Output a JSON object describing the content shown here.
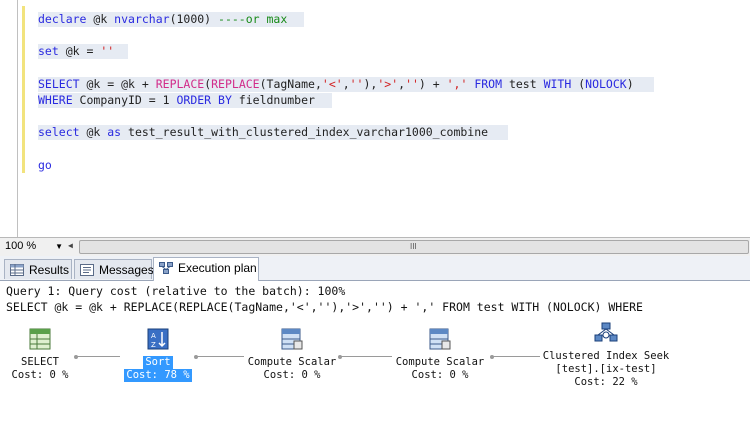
{
  "editor": {
    "lines": [
      {
        "parts": [
          {
            "t": "declare",
            "c": "kw"
          },
          {
            "t": " @k ",
            "c": "plain"
          },
          {
            "t": "nvarchar",
            "c": "kw"
          },
          {
            "t": "(1000) ",
            "c": "plain"
          },
          {
            "t": "----or max",
            "c": "cmt"
          }
        ]
      },
      {
        "parts": [
          {
            "t": "set",
            "c": "kw"
          },
          {
            "t": " @k = ",
            "c": "plain"
          },
          {
            "t": "''",
            "c": "str"
          }
        ]
      },
      {
        "parts": [
          {
            "t": "SELECT",
            "c": "kw"
          },
          {
            "t": " @k = @k + ",
            "c": "plain"
          },
          {
            "t": "REPLACE",
            "c": "fn"
          },
          {
            "t": "(",
            "c": "plain"
          },
          {
            "t": "REPLACE",
            "c": "fn"
          },
          {
            "t": "(TagName,",
            "c": "plain"
          },
          {
            "t": "'<'",
            "c": "str"
          },
          {
            "t": ",",
            "c": "plain"
          },
          {
            "t": "''",
            "c": "str"
          },
          {
            "t": "),",
            "c": "plain"
          },
          {
            "t": "'>'",
            "c": "str"
          },
          {
            "t": ",",
            "c": "plain"
          },
          {
            "t": "''",
            "c": "str"
          },
          {
            "t": ") + ",
            "c": "plain"
          },
          {
            "t": "','",
            "c": "str"
          },
          {
            "t": " FROM ",
            "c": "kw"
          },
          {
            "t": "test ",
            "c": "plain"
          },
          {
            "t": "WITH",
            "c": "kw"
          },
          {
            "t": " (",
            "c": "plain"
          },
          {
            "t": "NOLOCK",
            "c": "kw"
          },
          {
            "t": ")",
            "c": "plain"
          }
        ]
      },
      {
        "parts": [
          {
            "t": "WHERE",
            "c": "kw"
          },
          {
            "t": " CompanyID = 1 ",
            "c": "plain"
          },
          {
            "t": "ORDER BY",
            "c": "kw"
          },
          {
            "t": " fieldnumber",
            "c": "plain"
          }
        ]
      },
      {
        "parts": [
          {
            "t": "select",
            "c": "kw"
          },
          {
            "t": " @k ",
            "c": "plain"
          },
          {
            "t": "as",
            "c": "kw"
          },
          {
            "t": " test_result_with_clustered_index_varchar1000_combine",
            "c": "plain"
          }
        ]
      },
      {
        "parts": [
          {
            "t": "go",
            "c": "kw"
          }
        ]
      }
    ]
  },
  "zoom": {
    "value": "100 %"
  },
  "scrollbar": {
    "grip": "III"
  },
  "tabs": [
    {
      "label": "Results",
      "icon": "grid-icon"
    },
    {
      "label": "Messages",
      "icon": "messages-icon"
    },
    {
      "label": "Execution plan",
      "icon": "plan-icon"
    }
  ],
  "plan": {
    "query_line": "Query 1: Query cost (relative to the batch): 100%",
    "sql_line": "SELECT @k = @k + REPLACE(REPLACE(TagName,'<',''),'>','') + ',' FROM test WITH (NOLOCK) WHERE",
    "nodes": [
      {
        "lines": [
          "SELECT",
          "Cost: 0 %"
        ],
        "icon": "select-icon"
      },
      {
        "lines": [
          "Sort",
          "Cost: 78 %"
        ],
        "icon": "sort-icon",
        "selected": true
      },
      {
        "lines": [
          "Compute Scalar",
          "Cost: 0 %"
        ],
        "icon": "compute-scalar-icon"
      },
      {
        "lines": [
          "Compute Scalar",
          "Cost: 0 %"
        ],
        "icon": "compute-scalar-icon"
      },
      {
        "lines": [
          "Clustered Index Seek",
          "[test].[ix-test]",
          "Cost: 22 %"
        ],
        "icon": "clustered-index-seek-icon"
      }
    ]
  },
  "colors": {
    "keyword": "#2a2ae0",
    "string": "#d22020",
    "comment": "#178a17",
    "function": "#d22c8a",
    "selected_node": "#3399ff",
    "gutter": "#f2e37d"
  }
}
